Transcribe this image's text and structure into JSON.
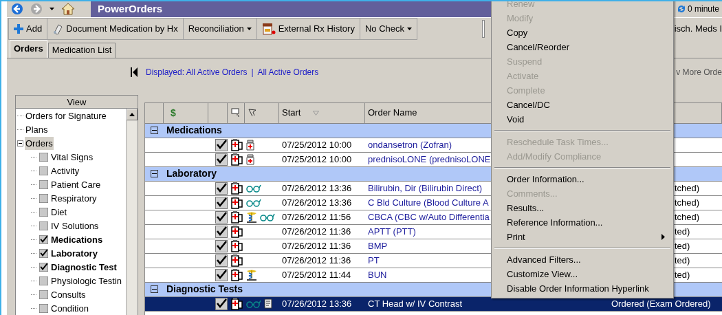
{
  "title_bar": {
    "title": "PowerOrders",
    "refresh_text": "0 minute"
  },
  "toolbar": {
    "buttons": [
      {
        "label": "Add",
        "kind": "add"
      },
      {
        "label": "Document Medication by Hx",
        "kind": "document"
      },
      {
        "label": "Reconciliation",
        "kind": "dropdown"
      },
      {
        "label": "External Rx History",
        "kind": "rx"
      },
      {
        "label": "No Check",
        "kind": "dropdown"
      }
    ],
    "right_button": "isch. Meds I"
  },
  "tabs": [
    {
      "label": "Orders",
      "selected": true
    },
    {
      "label": "Medication List",
      "selected": false
    }
  ],
  "filter_bar": {
    "displayed": "Displayed: All Active Orders",
    "separator": "|",
    "current": "All Active Orders",
    "right_link": "v More Orde"
  },
  "view_panel": {
    "header": "View",
    "items": [
      {
        "label": "Orders for Signature",
        "selected": false
      },
      {
        "label": "Plans",
        "selected": false
      },
      {
        "label": "Orders",
        "selected": true,
        "expanded": true,
        "children": [
          {
            "label": "Vital Signs",
            "checked": false
          },
          {
            "label": "Activity",
            "checked": false
          },
          {
            "label": "Patient Care",
            "checked": false
          },
          {
            "label": "Respiratory",
            "checked": false
          },
          {
            "label": "Diet",
            "checked": false
          },
          {
            "label": "IV Solutions",
            "checked": false
          },
          {
            "label": "Medications",
            "checked": true
          },
          {
            "label": "Laboratory",
            "checked": true
          },
          {
            "label": "Diagnostic Test",
            "checked": true
          },
          {
            "label": "Physiologic Testin",
            "checked": false
          },
          {
            "label": "Consults",
            "checked": false
          },
          {
            "label": "Condition",
            "checked": false
          }
        ]
      }
    ]
  },
  "table": {
    "columns": [
      {
        "label": "$"
      },
      {
        "label": "Start",
        "sorted": true
      },
      {
        "label": "Order Name"
      }
    ],
    "groups": [
      {
        "name": "Medications",
        "expanded": true,
        "rows": [
          {
            "checked": true,
            "pill": true,
            "start": "07/25/2012 10:00",
            "order_name": "ondansetron (Zofran)",
            "selected": false
          },
          {
            "checked": true,
            "pill": true,
            "start": "07/25/2012 10:00",
            "order_name": "prednisoLONE (prednisoLONE",
            "selected": false
          }
        ]
      },
      {
        "name": "Laboratory",
        "expanded": true,
        "rows": [
          {
            "checked": true,
            "glasses": true,
            "start": "07/26/2012 13:36",
            "order_name": "Bilirubin, Dir (Bilirubin Direct)",
            "status": "tched)",
            "selected": false
          },
          {
            "checked": true,
            "glasses": true,
            "start": "07/26/2012 13:36",
            "order_name": "C Bld Culture (Blood Culture A",
            "status": "tched)",
            "selected": false
          },
          {
            "checked": true,
            "caduceus": true,
            "glasses": true,
            "start": "07/26/2012 11:56",
            "order_name": "CBCA (CBC w/Auto Differentia",
            "status": "tched)",
            "selected": false
          },
          {
            "checked": true,
            "start": "07/26/2012 11:36",
            "order_name": "APTT (PTT)",
            "status": "ted)",
            "selected": false
          },
          {
            "checked": true,
            "start": "07/26/2012 11:36",
            "order_name": "BMP",
            "status": "ted)",
            "selected": false
          },
          {
            "checked": true,
            "start": "07/26/2012 11:36",
            "order_name": "PT",
            "status": "ted)",
            "selected": false
          },
          {
            "checked": true,
            "caduceus": true,
            "start": "07/25/2012 11:44",
            "order_name": "BUN",
            "status": "ted)",
            "selected": false
          }
        ]
      },
      {
        "name": "Diagnostic Tests",
        "expanded": true,
        "rows": [
          {
            "checked": true,
            "glasses": true,
            "document": true,
            "start": "07/26/2012 13:36",
            "order_name": "CT Head w/ IV Contrast",
            "status": "Ordered (Exam Ordered)",
            "selected": true
          }
        ]
      }
    ]
  },
  "context_menu": {
    "items": [
      {
        "kind": "item",
        "label": "Renew",
        "disabled": true
      },
      {
        "kind": "item",
        "label": "Modify",
        "disabled": true
      },
      {
        "kind": "item",
        "label": "Copy",
        "disabled": false
      },
      {
        "kind": "item",
        "label": "Cancel/Reorder",
        "disabled": false
      },
      {
        "kind": "item",
        "label": "Suspend",
        "disabled": true
      },
      {
        "kind": "item",
        "label": "Activate",
        "disabled": true
      },
      {
        "kind": "item",
        "label": "Complete",
        "disabled": true
      },
      {
        "kind": "item",
        "label": "Cancel/DC",
        "disabled": false
      },
      {
        "kind": "item",
        "label": "Void",
        "disabled": false
      },
      {
        "kind": "separator"
      },
      {
        "kind": "item",
        "label": "Reschedule Task Times...",
        "disabled": true
      },
      {
        "kind": "item",
        "label": "Add/Modify Compliance",
        "disabled": true
      },
      {
        "kind": "separator"
      },
      {
        "kind": "item",
        "label": "Order Information...",
        "disabled": false
      },
      {
        "kind": "item",
        "label": "Comments...",
        "disabled": true
      },
      {
        "kind": "item",
        "label": "Results...",
        "disabled": false
      },
      {
        "kind": "item",
        "label": "Reference Information...",
        "disabled": false
      },
      {
        "kind": "submenu",
        "label": "Print",
        "disabled": false
      },
      {
        "kind": "separator"
      },
      {
        "kind": "item",
        "label": "Advanced Filters...",
        "disabled": false
      },
      {
        "kind": "item",
        "label": "Customize View...",
        "disabled": false
      },
      {
        "kind": "item",
        "label": "Disable Order Information Hyperlink",
        "disabled": false
      }
    ]
  }
}
